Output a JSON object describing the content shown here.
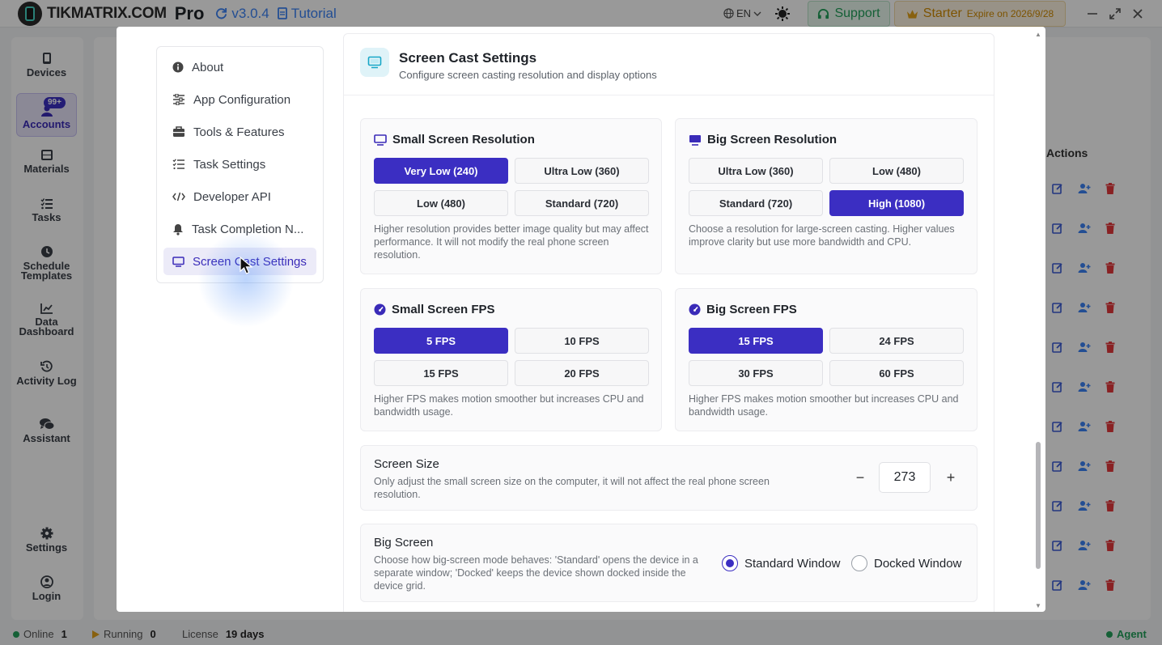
{
  "app": {
    "brand": "TIKMATRIX.COM",
    "edition": "Pro",
    "version": "v3.0.4",
    "tutorial": "Tutorial",
    "language": "EN",
    "support": "Support",
    "plan": "Starter",
    "expire": "Expire on 2026/9/28"
  },
  "sidebar": {
    "items": [
      {
        "label": "Devices"
      },
      {
        "label": "Accounts",
        "badge": "99+"
      },
      {
        "label": "Materials"
      },
      {
        "label": "Tasks"
      },
      {
        "label": "Schedule Templates"
      },
      {
        "label": "Data Dashboard"
      },
      {
        "label": "Activity Log"
      },
      {
        "label": "Assistant"
      },
      {
        "label": "Settings"
      },
      {
        "label": "Login"
      }
    ]
  },
  "background": {
    "actions_header": "Actions"
  },
  "status": {
    "online_label": "Online",
    "online_count": "1",
    "running_label": "Running",
    "running_count": "0",
    "license_label": "License",
    "license_value": "19 days",
    "agent": "Agent"
  },
  "settings_menu": {
    "items": [
      {
        "label": "About"
      },
      {
        "label": "App Configuration"
      },
      {
        "label": "Tools & Features"
      },
      {
        "label": "Task Settings"
      },
      {
        "label": "Developer API"
      },
      {
        "label": "Task Completion N..."
      },
      {
        "label": "Screen Cast Settings"
      }
    ]
  },
  "screen_cast": {
    "title": "Screen Cast Settings",
    "subtitle": "Configure screen casting resolution and display options",
    "small_resolution": {
      "title": "Small Screen Resolution",
      "options": [
        "Very Low (240)",
        "Ultra Low (360)",
        "Low (480)",
        "Standard (720)"
      ],
      "selected": "Very Low (240)",
      "description": "Higher resolution provides better image quality but may affect performance. It will not modify the real phone screen resolution."
    },
    "big_resolution": {
      "title": "Big Screen Resolution",
      "options": [
        "Ultra Low (360)",
        "Low (480)",
        "Standard (720)",
        "High (1080)"
      ],
      "selected": "High (1080)",
      "description": "Choose a resolution for large-screen casting. Higher values improve clarity but use more bandwidth and CPU."
    },
    "small_fps": {
      "title": "Small Screen FPS",
      "options": [
        "5 FPS",
        "10 FPS",
        "15 FPS",
        "20 FPS"
      ],
      "selected": "5 FPS",
      "description": "Higher FPS makes motion smoother but increases CPU and bandwidth usage."
    },
    "big_fps": {
      "title": "Big Screen FPS",
      "options": [
        "15 FPS",
        "24 FPS",
        "30 FPS",
        "60 FPS"
      ],
      "selected": "15 FPS",
      "description": "Higher FPS makes motion smoother but increases CPU and bandwidth usage."
    },
    "screen_size": {
      "label": "Screen Size",
      "description": "Only adjust the small screen size on the computer, it will not affect the real phone screen resolution.",
      "value": "273",
      "minus": "−",
      "plus": "+"
    },
    "big_screen": {
      "label": "Big Screen",
      "description": "Choose how big-screen mode behaves: 'Standard' opens the device in a separate window; 'Docked' keeps the device shown docked inside the device grid.",
      "options": [
        "Standard Window",
        "Docked Window"
      ],
      "selected": "Standard Window"
    }
  },
  "colors": {
    "accent": "#3b2ec2",
    "link": "#3b82f6",
    "support_green": "#22a05a",
    "starter_gold": "#d18a00",
    "danger": "#e5383b"
  }
}
